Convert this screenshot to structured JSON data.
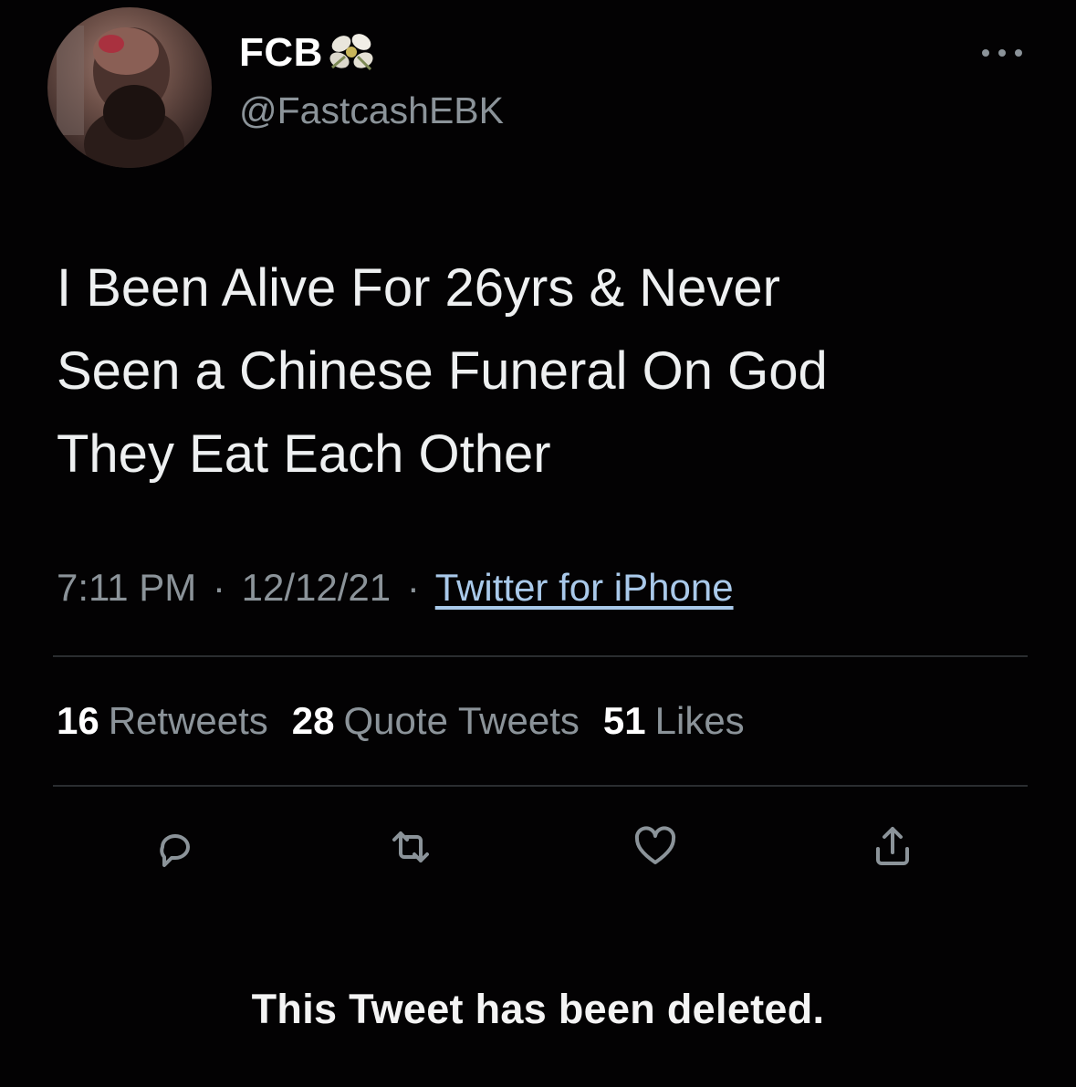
{
  "tweet": {
    "display_name": "FCB",
    "name_emoji": "flower-emoji",
    "handle": "@FastcashEBK",
    "text": "I Been Alive For 26yrs & Never\nSeen a Chinese Funeral On God\nThey Eat Each Other",
    "time": "7:11 PM",
    "date": "12/12/21",
    "separator": "·",
    "source": "Twitter for iPhone",
    "stats": {
      "retweets_count": "16",
      "retweets_label": "Retweets",
      "quotes_count": "28",
      "quotes_label": "Quote Tweets",
      "likes_count": "51",
      "likes_label": "Likes"
    },
    "actions": [
      "reply-icon",
      "retweet-icon",
      "like-icon",
      "share-icon"
    ],
    "deleted_notice": "This Tweet has been deleted."
  },
  "colors": {
    "background": "#030203",
    "text": "#eef0f1",
    "secondary": "#8b9399",
    "link": "#a9c9ea",
    "divider": "#2a2d30"
  }
}
